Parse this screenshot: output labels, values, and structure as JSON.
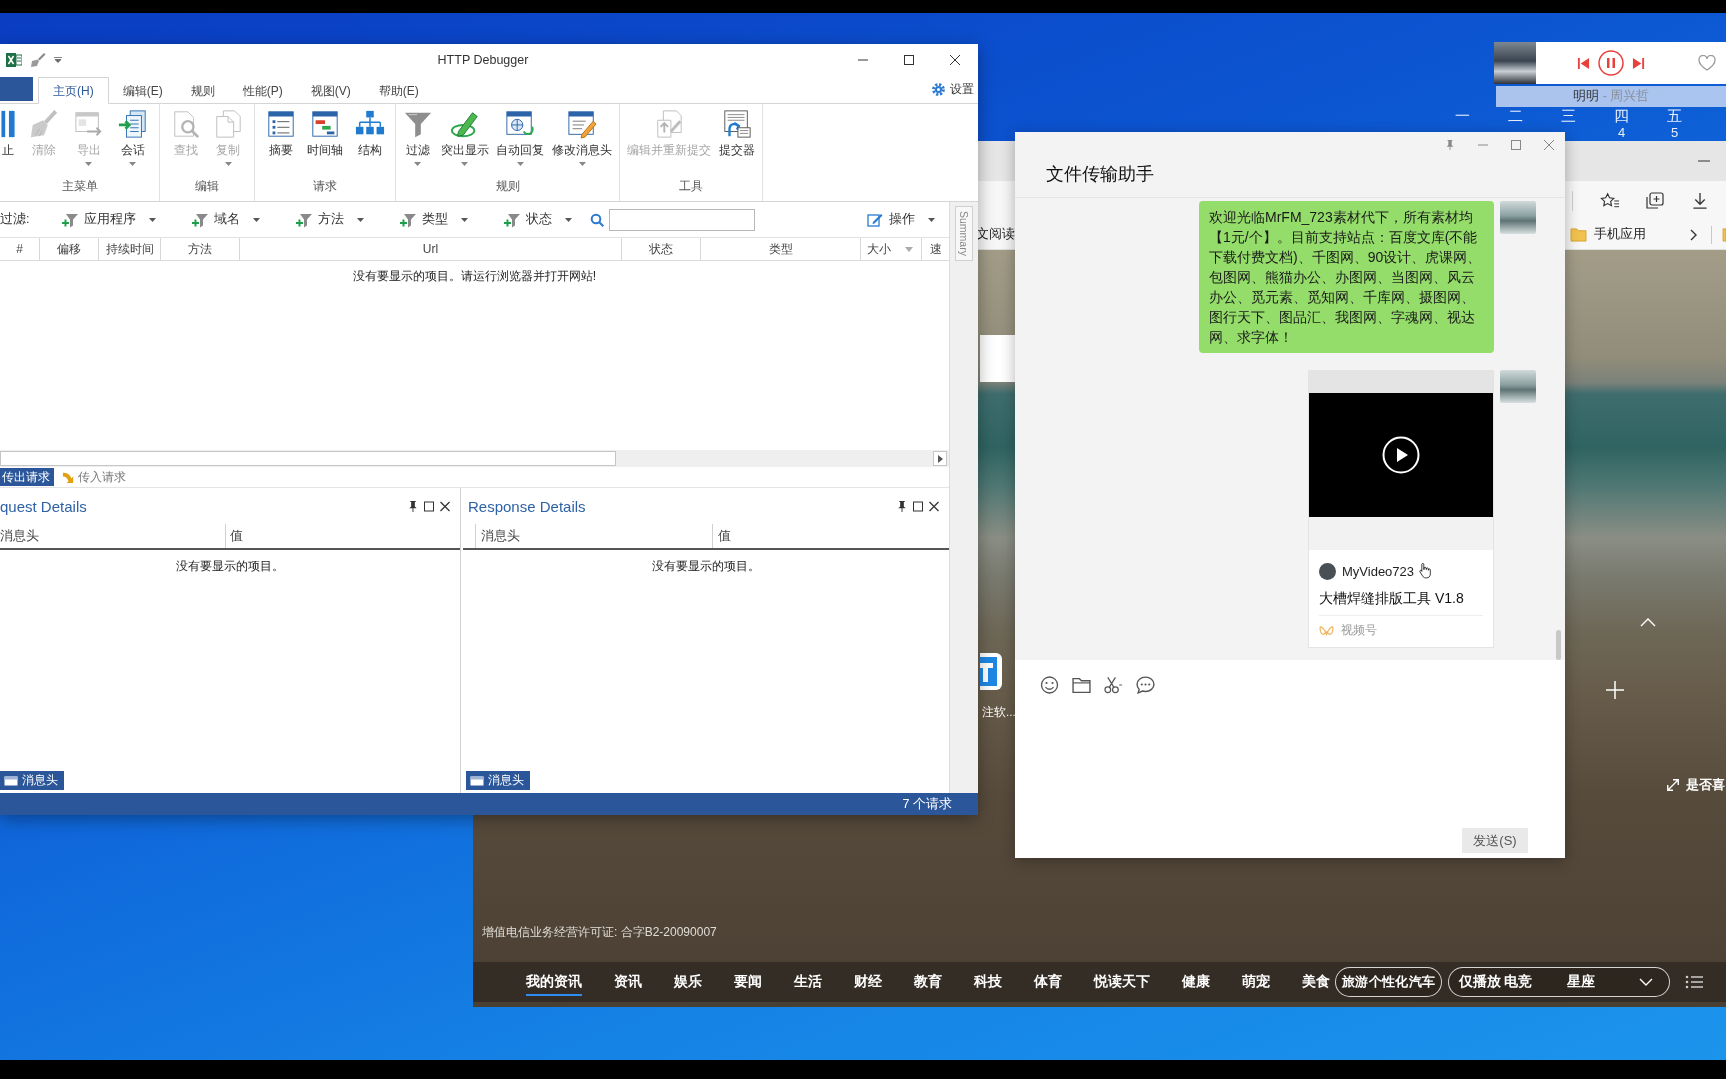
{
  "music_player": {
    "song": "明明",
    "artist": "- 周兴哲",
    "playing": true
  },
  "calendar": {
    "weekdays": [
      "一",
      "二",
      "三",
      "四",
      "五"
    ],
    "days": [
      "4",
      "5"
    ]
  },
  "browser": {
    "bookmarks": [
      {
        "label": "文阅读",
        "folder": false
      },
      {
        "label": "手机应用",
        "folder": true
      }
    ],
    "page": {
      "shortcut_label": "注软...",
      "feedback": "是否喜",
      "license": "增值电信业务经营许可证: 合字B2-20090007",
      "news_tabs": [
        {
          "label": "我的资讯",
          "selected": true
        },
        {
          "label": "资讯",
          "selected": false
        },
        {
          "label": "娱乐",
          "selected": false
        },
        {
          "label": "要闻",
          "selected": false
        },
        {
          "label": "生活",
          "selected": false
        },
        {
          "label": "财经",
          "selected": false
        },
        {
          "label": "教育",
          "selected": false
        },
        {
          "label": "科技",
          "selected": false
        },
        {
          "label": "体育",
          "selected": false
        },
        {
          "label": "悦读天下",
          "selected": false
        },
        {
          "label": "健康",
          "selected": false
        },
        {
          "label": "萌宠",
          "selected": false
        },
        {
          "label": "美食",
          "selected": false
        }
      ],
      "pills": [
        {
          "dropdown": false,
          "items": [
            {
              "label": "旅游",
              "selected": false
            },
            {
              "label": "个性化",
              "selected": false
            },
            {
              "label": "汽车",
              "selected": false
            }
          ]
        },
        {
          "dropdown": true,
          "items": [
            {
              "label": "仅播放",
              "selected": false
            },
            {
              "label": "电竞",
              "selected": false
            },
            {
              "label": "星座",
              "selected": false
            }
          ]
        }
      ]
    }
  },
  "http_debugger": {
    "title": "HTTP Debugger",
    "ribbon_tabs": [
      {
        "label": "主页(H)",
        "selected": true
      },
      {
        "label": "编辑(E)",
        "selected": false
      },
      {
        "label": "规则",
        "selected": false
      },
      {
        "label": "性能(P)",
        "selected": false
      },
      {
        "label": "视图(V)",
        "selected": false
      },
      {
        "label": "帮助(E)",
        "selected": false
      }
    ],
    "settings": "设置",
    "ribbon_groups": [
      {
        "label": "主菜单",
        "buttons": [
          {
            "label": "止",
            "disabled": false,
            "dropdown": false
          },
          {
            "label": "清除",
            "disabled": true,
            "dropdown": false
          },
          {
            "label": "导出",
            "disabled": true,
            "dropdown": true
          },
          {
            "label": "会话",
            "disabled": false,
            "dropdown": true
          }
        ]
      },
      {
        "label": "编辑",
        "buttons": [
          {
            "label": "查找",
            "disabled": true,
            "dropdown": false
          },
          {
            "label": "复制",
            "disabled": true,
            "dropdown": true
          }
        ]
      },
      {
        "label": "请求",
        "buttons": [
          {
            "label": "摘要",
            "disabled": false,
            "dropdown": false
          },
          {
            "label": "时间轴",
            "disabled": false,
            "dropdown": false
          },
          {
            "label": "结构",
            "disabled": false,
            "dropdown": false
          }
        ]
      },
      {
        "label": "规则",
        "buttons": [
          {
            "label": "过滤",
            "disabled": false,
            "dropdown": true
          },
          {
            "label": "突出显示",
            "disabled": false,
            "dropdown": true
          },
          {
            "label": "自动回复",
            "disabled": false,
            "dropdown": true
          },
          {
            "label": "修改消息头",
            "disabled": false,
            "dropdown": true
          }
        ]
      },
      {
        "label": "工具",
        "buttons": [
          {
            "label": "编辑并重新提交",
            "disabled": true,
            "dropdown": false
          },
          {
            "label": "提交器",
            "disabled": false,
            "dropdown": false
          }
        ]
      }
    ],
    "filter_label": "过滤:",
    "filters": [
      "应用程序",
      "域名",
      "方法",
      "类型",
      "状态"
    ],
    "actions_button": "操作",
    "side_tab": "Summary",
    "columns": [
      {
        "label": "#",
        "sorted": false
      },
      {
        "label": "偏移",
        "sorted": false
      },
      {
        "label": "持续时间",
        "sorted": false
      },
      {
        "label": "方法",
        "sorted": false
      },
      {
        "label": "Url",
        "sorted": false
      },
      {
        "label": "状态",
        "sorted": false
      },
      {
        "label": "类型",
        "sorted": false
      },
      {
        "label": "大小",
        "sorted": true
      },
      {
        "label": "速",
        "sorted": false
      }
    ],
    "empty_message": "没有要显示的项目。请运行浏览器并打开网站!",
    "direction_tabs": [
      {
        "label": "传出请求",
        "selected": true
      },
      {
        "label": "传入请求",
        "selected": false
      }
    ],
    "panels": [
      {
        "title": "quest Details",
        "columns": [
          "消息头",
          "值"
        ],
        "empty_message": "没有要显示的项目。",
        "footer_tab": "消息头"
      },
      {
        "title": "Response Details",
        "columns": [
          "消息头",
          "值"
        ],
        "empty_message": "没有要显示的项目。",
        "footer_tab": "消息头"
      }
    ],
    "status": "7 个请求"
  },
  "wechat": {
    "title": "文件传输助手",
    "messages": [
      {
        "kind": "text",
        "text": "欢迎光临MrFM_723素材代下，所有素材均【1元/个】。目前支持站点：百度文库(不能下载付费文档)、千图网、90设计、虎课网、包图网、熊猫办公、办图网、当图网、风云办公、觅元素、觅知网、千库网、摄图网、图行天下、图品汇、我图网、字魂网、视达网、求字体！"
      },
      {
        "kind": "video",
        "author": "MyVideo723",
        "title": "大槽焊缝排版工具 V1.8",
        "source": "视频号"
      }
    ],
    "send_button": "发送(S)"
  }
}
